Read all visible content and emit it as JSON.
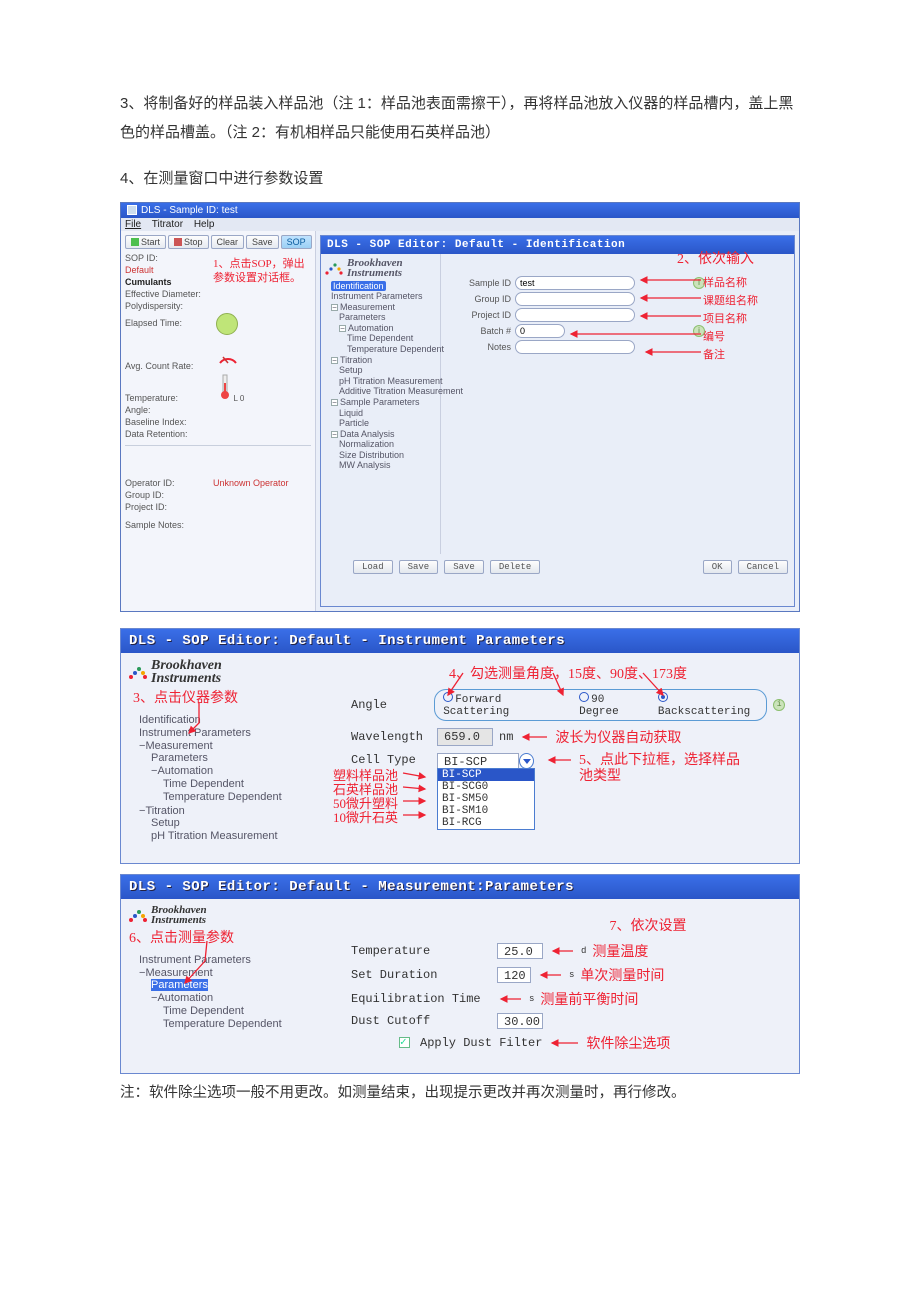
{
  "paragraphs": {
    "p3": "3、将制备好的样品装入样品池（注 1：样品池表面需擦干），再将样品池放入仪器的样品槽内，盖上黑色的样品槽盖。（注 2：有机相样品只能使用石英样品池）",
    "p4": "4、在测量窗口中进行参数设置"
  },
  "win1": {
    "title": "DLS - Sample ID: test",
    "menus": [
      "File",
      "Titrator",
      "Help"
    ],
    "toolbar": {
      "start": "Start",
      "stop": "Stop",
      "clear": "Clear",
      "save": "Save",
      "sop": "SOP"
    },
    "left": {
      "sop_id_label": "SOP ID:",
      "default": "Default",
      "cumulants": "Cumulants",
      "eff_dia": "Effective Diameter:",
      "polydisp": "Polydispersity:",
      "elapsed": "Elapsed Time:",
      "avg_count": "Avg. Count Rate:",
      "temperature": "Temperature:",
      "angle": "Angle:",
      "baseline": "Baseline Index:",
      "retention": "Data Retention:",
      "operator_l": "Operator ID:",
      "operator_v": "Unknown Operator",
      "group_id": "Group ID:",
      "project_id": "Project ID:",
      "samplenotes": "Sample Notes:"
    },
    "logo": {
      "b": "Brookhaven",
      "i": "Instruments"
    },
    "sop": {
      "title": "DLS - SOP Editor: Default - Identification",
      "tree": {
        "ident": "Identification",
        "instparam": "Instrument Parameters",
        "meas": "Measurement",
        "params": "Parameters",
        "auto": "Automation",
        "tdep": "Time Dependent",
        "temp_dep": "Temperature Dependent",
        "titration": "Titration",
        "setup": "Setup",
        "phtit": "pH Titration Measurement",
        "addtit": "Additive Titration Measurement",
        "sampleparam": "Sample Parameters",
        "liquid": "Liquid",
        "particle": "Particle",
        "dataan": "Data Analysis",
        "norm": "Normalization",
        "sizedist": "Size Distribution",
        "mw": "MW Analysis"
      },
      "form": {
        "sample_id_l": "Sample ID",
        "sample_id_v": "test",
        "group_id_l": "Group ID",
        "project_id_l": "Project ID",
        "batch_l": "Batch #",
        "batch_v": "0",
        "notes_l": "Notes"
      },
      "btns": {
        "load": "Load",
        "save": "Save",
        "saveas": "Save",
        "delete": "Delete",
        "ok": "OK",
        "cancel": "Cancel"
      }
    },
    "ann": {
      "a1": "1、点击SOP，弹出参数设置对话框。",
      "a2_title": "2、依次输入",
      "a2_sample": "样品名称",
      "a2_group": "课题组名称",
      "a2_project": "项目名称",
      "a2_batch": "编号",
      "a2_notes": "备注"
    }
  },
  "s2": {
    "title": "DLS - SOP Editor: Default - Instrument Parameters",
    "tree": {
      "ident": "Identification",
      "instparam": "Instrument Parameters",
      "meas": "Measurement",
      "params": "Parameters",
      "auto": "Automation",
      "tdep": "Time Dependent",
      "temp_dep": "Temperature Dependent",
      "titration": "Titration",
      "setup": "Setup",
      "phtit": "pH Titration Measurement"
    },
    "angle_l": "Angle",
    "angle_opts": {
      "fwd": "Forward Scattering",
      "deg90": "90 Degree",
      "back": "Backscattering"
    },
    "wavelength_l": "Wavelength",
    "wavelength_v": "659.0",
    "wavelength_u": "nm",
    "celltype_l": "Cell Type",
    "celltype_v": "BI-SCP",
    "cell_opts": [
      "BI-SCP",
      "BI-SCG0",
      "BI-SM50",
      "BI-SM10",
      "BI-RCG"
    ],
    "ann": {
      "a3": "3、点击仪器参数",
      "a4": "4、勾选测量角度，15度、90度、173度",
      "a5": "5、点此下拉框，选择样品池类型",
      "a_wav": "波长为仪器自动获取",
      "cell_plastic": "塑料样品池",
      "cell_quartz": "石英样品池",
      "cell_50ul": "50微升塑料",
      "cell_10ul": "10微升石英"
    }
  },
  "s3": {
    "title": "DLS - SOP Editor: Default - Measurement:Parameters",
    "tree": {
      "instparam": "Instrument Parameters",
      "meas": "Measurement",
      "params": "Parameters",
      "auto": "Automation",
      "tdep": "Time Dependent",
      "temp_dep": "Temperature Dependent"
    },
    "temp_l": "Temperature",
    "temp_v": "25.0",
    "temp_u": "d",
    "dur_l": "Set Duration",
    "dur_v": "120",
    "dur_u": "s",
    "eq_l": "Equilibration Time",
    "eq_u": "s",
    "dust_l": "Dust Cutoff",
    "dust_v": "30.00",
    "apply_dust": "Apply Dust Filter",
    "ann": {
      "a6": "6、点击测量参数",
      "a7": "7、依次设置",
      "a_temp": "测量温度",
      "a_dur": "单次测量时间",
      "a_eq": "测量前平衡时间",
      "a_dust": "软件除尘选项"
    }
  },
  "footnote": "注：软件除尘选项一般不用更改。如测量结束，出现提示更改并再次测量时，再行修改。"
}
